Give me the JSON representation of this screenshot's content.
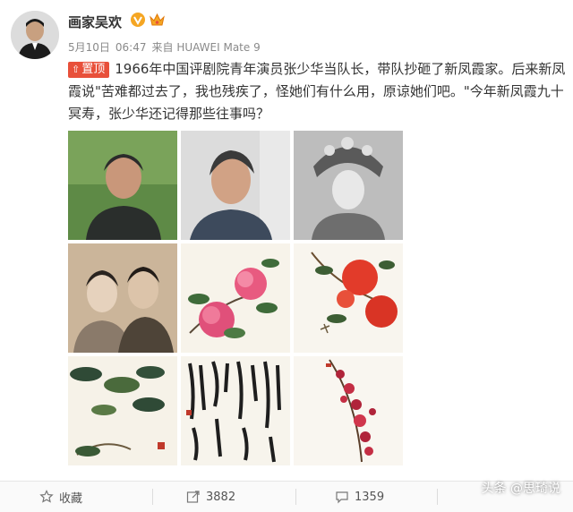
{
  "user": {
    "name": "画家吴欢",
    "verified_icon": "verified-v-icon",
    "badge_icon": "crown-badge-icon"
  },
  "meta": {
    "date": "5月10日",
    "time": "06:47",
    "source": "来自 HUAWEI Mate 9"
  },
  "post": {
    "pinned_label": "置顶",
    "text": "1966年中国评剧院青年演员张少华当队长，带队抄砸了新凤霞家。后来新凤霞说\"苦难都过去了，我也残疾了，怪她们有什么用，原谅她们吧。\"今年新凤霞九十冥寿，张少华还记得那些往事吗？"
  },
  "actions": {
    "favorite": "收藏",
    "repost": "3882",
    "comment": "1359"
  },
  "watermark": "头条 @思琦说",
  "colors": {
    "pin_red": "#e8503a",
    "verified_orange": "#f5a623",
    "text": "#333333",
    "meta_gray": "#8a8a8a"
  }
}
